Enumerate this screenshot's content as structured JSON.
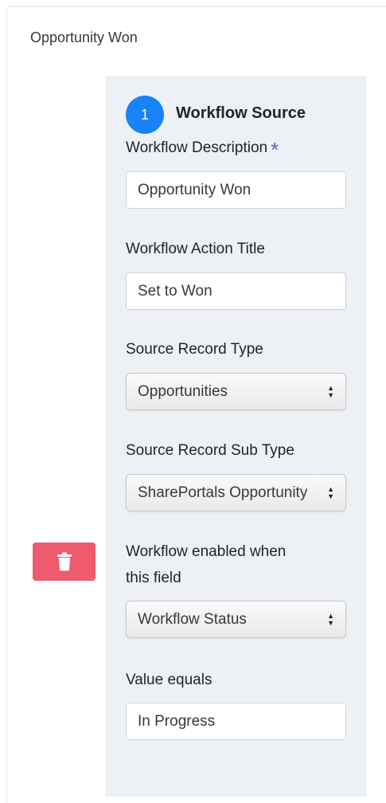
{
  "card": {
    "title": "Opportunity Won"
  },
  "step": {
    "number": "1",
    "title": "Workflow Source"
  },
  "fields": {
    "description": {
      "label": "Workflow Description",
      "required_mark": "*",
      "value": "Opportunity Won"
    },
    "action_title": {
      "label": "Workflow Action Title",
      "value": "Set to Won"
    },
    "record_type": {
      "label": "Source Record Type",
      "value": "Opportunities"
    },
    "record_sub_type": {
      "label": "Source Record Sub Type",
      "value": "SharePortals Opportunity"
    },
    "enabled_field": {
      "label_line1": "Workflow enabled when",
      "label_line2": "this field",
      "value": "Workflow Status"
    },
    "value_equals": {
      "label": "Value equals",
      "value": "In Progress"
    }
  },
  "colors": {
    "accent": "#1a82f7",
    "danger": "#ef5b6e",
    "panel": "#edf1f5",
    "required": "#6a5acd"
  },
  "icons": {
    "delete": "trash-icon",
    "select_arrows": "updown-arrows-icon"
  }
}
